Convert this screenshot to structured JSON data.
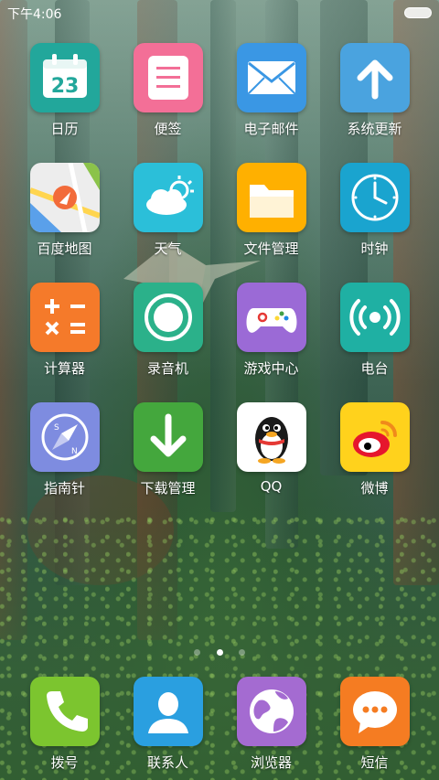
{
  "status_bar": {
    "time": "下午4:06"
  },
  "apps": [
    {
      "label": "日历",
      "icon": "calendar-icon",
      "color": "#26a69a",
      "text": "23"
    },
    {
      "label": "便签",
      "icon": "notes-icon",
      "color": "#f06292"
    },
    {
      "label": "电子邮件",
      "icon": "mail-icon",
      "color": "#42a5f5"
    },
    {
      "label": "系统更新",
      "icon": "update-arrow-icon",
      "color": "#4aa3df"
    },
    {
      "label": "百度地图",
      "icon": "map-icon",
      "color": "#eeeeee"
    },
    {
      "label": "天气",
      "icon": "weather-icon",
      "color": "#26c6da"
    },
    {
      "label": "文件管理",
      "icon": "folder-icon",
      "color": "#ffb300"
    },
    {
      "label": "时钟",
      "icon": "clock-icon",
      "color": "#1eaad1"
    },
    {
      "label": "计算器",
      "icon": "calculator-icon",
      "color": "#f57c2b"
    },
    {
      "label": "录音机",
      "icon": "recorder-icon",
      "color": "#2bb18a"
    },
    {
      "label": "游戏中心",
      "icon": "gamepad-icon",
      "color": "#9b6ad6"
    },
    {
      "label": "电台",
      "icon": "radio-icon",
      "color": "#20b2a4"
    },
    {
      "label": "指南针",
      "icon": "compass-icon",
      "color": "#7e8ce0"
    },
    {
      "label": "下载管理",
      "icon": "download-icon",
      "color": "#43a83c"
    },
    {
      "label": "QQ",
      "icon": "qq-penguin-icon",
      "color": "#ffffff"
    },
    {
      "label": "微博",
      "icon": "weibo-icon",
      "color": "#ffd319"
    }
  ],
  "dock": [
    {
      "label": "拨号",
      "icon": "phone-icon",
      "color": "#7cc52f"
    },
    {
      "label": "联系人",
      "icon": "contacts-icon",
      "color": "#2a9fe0"
    },
    {
      "label": "浏览器",
      "icon": "browser-globe-icon",
      "color": "#a46bd1"
    },
    {
      "label": "短信",
      "icon": "message-icon",
      "color": "#f57c22"
    }
  ],
  "page_indicator": {
    "count": 3,
    "active": 2
  }
}
